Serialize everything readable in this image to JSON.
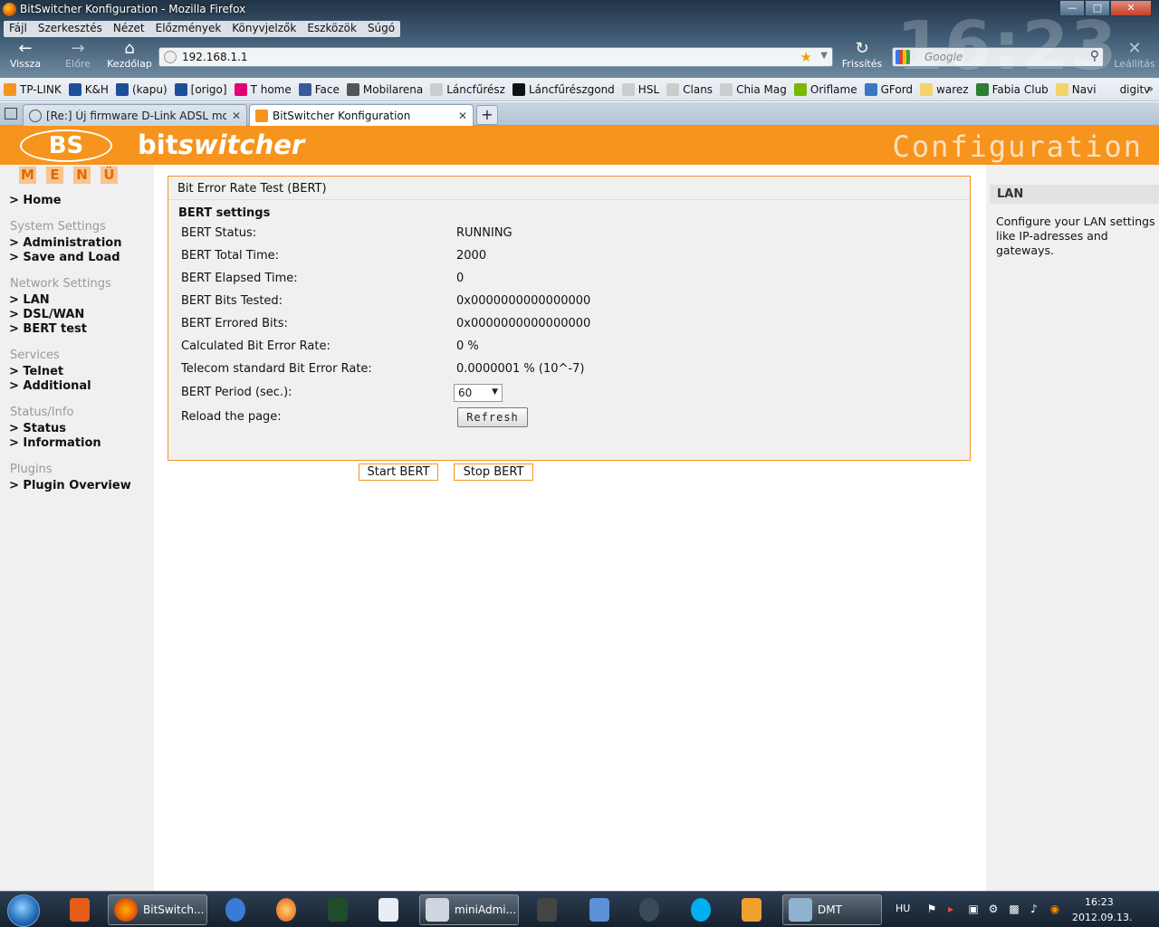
{
  "window": {
    "title": "BitSwitcher Konfiguration - Mozilla Firefox",
    "background_clock": "16:23"
  },
  "menubar": [
    "Fájl",
    "Szerkesztés",
    "Nézet",
    "Előzmények",
    "Könyvjelzők",
    "Eszközök",
    "Súgó"
  ],
  "nav": {
    "back": "Vissza",
    "forward": "Előre",
    "home": "Kezdőlap",
    "reload": "Frissítés",
    "stop": "Leállítás",
    "url": "192.168.1.1",
    "search_placeholder": "Google"
  },
  "bookmarks": [
    {
      "label": "TP-LINK",
      "color": "#f7941d"
    },
    {
      "label": "K&H",
      "color": "#1c4e9a"
    },
    {
      "label": "(kapu)",
      "color": "#1c4e9a"
    },
    {
      "label": "[origo]",
      "color": "#1c4e9a"
    },
    {
      "label": "T home",
      "color": "#e20074"
    },
    {
      "label": "Face",
      "color": "#3b5998"
    },
    {
      "label": "Mobilarena",
      "color": "#555555"
    },
    {
      "label": "Láncfűrész",
      "color": "#cccccc"
    },
    {
      "label": "Láncfűrészgond",
      "color": "#111111"
    },
    {
      "label": "HSL",
      "color": "#cccccc"
    },
    {
      "label": "Clans",
      "color": "#cccccc"
    },
    {
      "label": "Chia Mag",
      "color": "#cccccc"
    },
    {
      "label": "Oriflame",
      "color": "#7ab800"
    },
    {
      "label": "GFord",
      "color": "#3a78c3"
    },
    {
      "label": "warez",
      "color": "#f3d36b"
    },
    {
      "label": "Fabia Club",
      "color": "#2e7d32"
    },
    {
      "label": "Navi",
      "color": "#f3d36b"
    },
    {
      "label": "digitv",
      "color": "transparent"
    }
  ],
  "tabs": [
    {
      "label": "[Re:] Új firmware D-Link ADSL mode...",
      "active": false
    },
    {
      "label": "BitSwitcher Konfiguration",
      "active": true
    }
  ],
  "banner": {
    "logo": "BS",
    "brand_bold": "bit",
    "brand_italic": "switcher",
    "title": "Configuration"
  },
  "sidebar": {
    "menu_letters": [
      "M",
      "E",
      "N",
      "Ü"
    ],
    "home": "> Home",
    "sections": [
      {
        "heading": "System Settings",
        "links": [
          "> Administration",
          "> Save and Load"
        ]
      },
      {
        "heading": "Network Settings",
        "links": [
          "> LAN",
          "> DSL/WAN",
          "> BERT test"
        ]
      },
      {
        "heading": "Services",
        "links": [
          "> Telnet",
          "> Additional"
        ]
      },
      {
        "heading": "Status/Info",
        "links": [
          "> Status",
          "> Information"
        ]
      },
      {
        "heading": "Plugins",
        "links": [
          "> Plugin Overview"
        ]
      }
    ]
  },
  "main": {
    "box_title": "Bit Error Rate Test (BERT)",
    "subtitle": "BERT settings",
    "rows": [
      {
        "label": "BERT Status:",
        "value": "RUNNING"
      },
      {
        "label": "BERT Total Time:",
        "value": "2000"
      },
      {
        "label": "BERT Elapsed Time:",
        "value": "0"
      },
      {
        "label": "BERT Bits Tested:",
        "value": "0x0000000000000000"
      },
      {
        "label": "BERT Errored Bits:",
        "value": "0x0000000000000000"
      },
      {
        "label": "Calculated Bit Error Rate:",
        "value": "0 %"
      },
      {
        "label": "Telecom standard Bit Error Rate:",
        "value": "0.0000001 % (10^-7)"
      }
    ],
    "period_label": "BERT Period (sec.):",
    "period_value": "60",
    "reload_label": "Reload the page:",
    "refresh_button": "Refresh",
    "start_button": "Start BERT",
    "stop_button": "Stop BERT"
  },
  "help": {
    "title": "LAN",
    "text": "Configure your LAN settings like IP-adresses and gateways."
  },
  "taskbar": {
    "apps": [
      "BitSwitch...",
      "miniAdmi...",
      "DMT"
    ],
    "language": "HU",
    "time": "16:23",
    "date": "2012.09.13."
  }
}
